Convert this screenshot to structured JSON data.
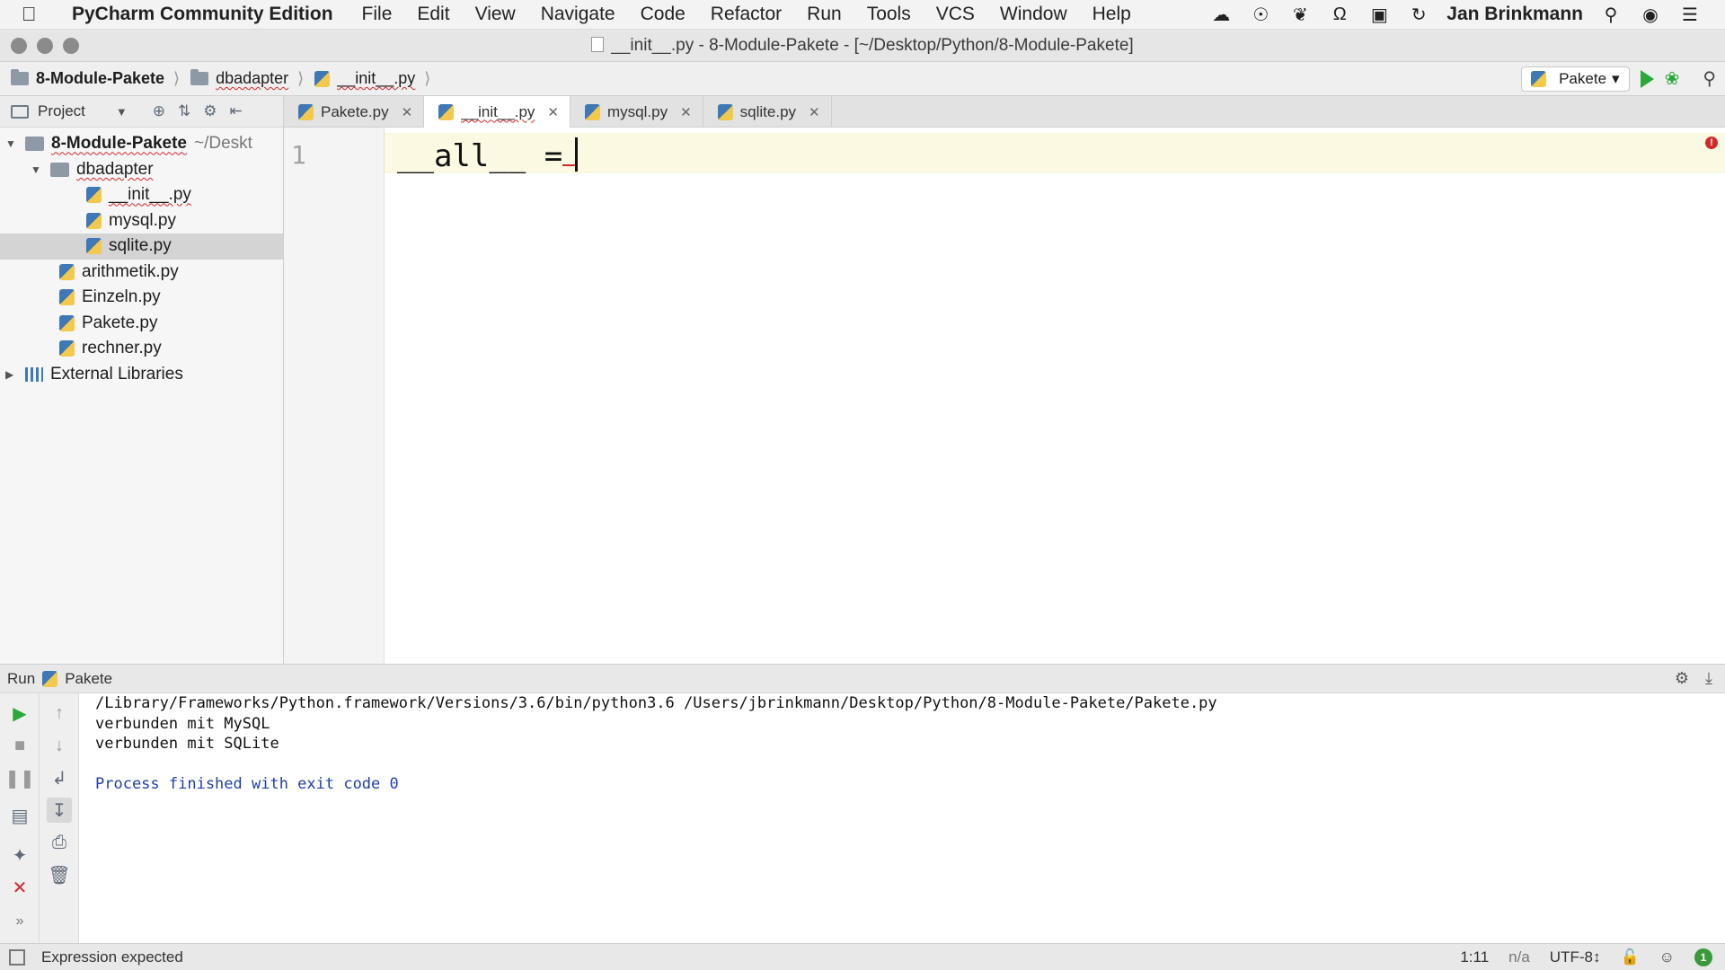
{
  "menubar": {
    "app_name": "PyCharm Community Edition",
    "items": [
      "File",
      "Edit",
      "View",
      "Navigate",
      "Code",
      "Refactor",
      "Run",
      "Tools",
      "VCS",
      "Window",
      "Help"
    ],
    "user": "Jan Brinkmann"
  },
  "window": {
    "title": "__init__.py - 8-Module-Pakete - [~/Desktop/Python/8-Module-Pakete]"
  },
  "navbar": {
    "crumbs": [
      "8-Module-Pakete",
      "dbadapter",
      "__init__.py"
    ],
    "run_config": "Pakete"
  },
  "project": {
    "header_label": "Project",
    "root": "8-Module-Pakete",
    "root_path": "~/Deskt",
    "tree": [
      {
        "label": "dbadapter"
      },
      {
        "label": "__init__.py"
      },
      {
        "label": "mysql.py"
      },
      {
        "label": "sqlite.py"
      },
      {
        "label": "arithmetik.py"
      },
      {
        "label": "Einzeln.py"
      },
      {
        "label": "Pakete.py"
      },
      {
        "label": "rechner.py"
      },
      {
        "label": "External Libraries"
      }
    ]
  },
  "editor": {
    "tabs": [
      {
        "label": "Pakete.py"
      },
      {
        "label": "__init__.py"
      },
      {
        "label": "mysql.py"
      },
      {
        "label": "sqlite.py"
      }
    ],
    "line_number": "1",
    "code": "__all__ ="
  },
  "run": {
    "label": "Run",
    "config": "Pakete",
    "console": [
      "/Library/Frameworks/Python.framework/Versions/3.6/bin/python3.6 /Users/jbrinkmann/Desktop/Python/8-Module-Pakete/Pakete.py",
      "verbunden mit MySQL",
      "verbunden mit SQLite",
      "",
      "Process finished with exit code 0"
    ]
  },
  "status": {
    "message": "Expression expected",
    "position": "1:11",
    "na": "n/a",
    "encoding": "UTF-8↕",
    "badge": "1"
  }
}
